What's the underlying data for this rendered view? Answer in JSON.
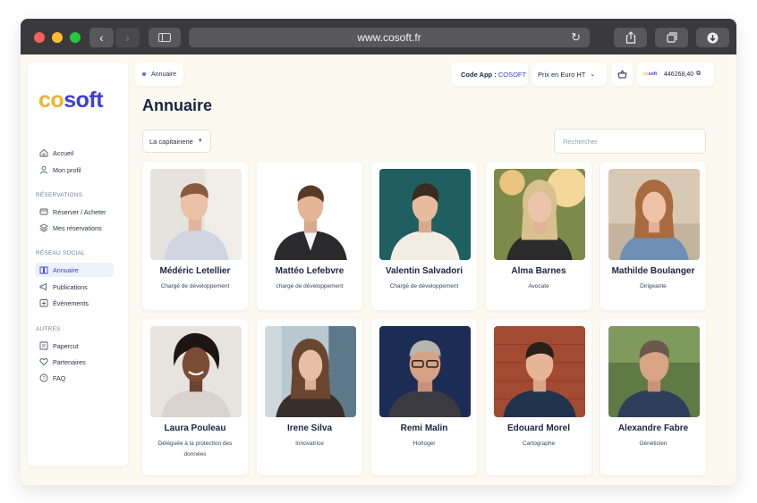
{
  "browser": {
    "url": "www.cosoft.fr"
  },
  "logo": {
    "part1": "co",
    "part2": "soft"
  },
  "sidebar": {
    "items_top": [
      {
        "label": "Accueil",
        "icon": "home-icon"
      },
      {
        "label": "Mon profil",
        "icon": "user-icon"
      }
    ],
    "section_reservations": "RÉSERVATIONS",
    "items_reservations": [
      {
        "label": "Réserver / Acheter",
        "icon": "cart-icon"
      },
      {
        "label": "Mes réservations",
        "icon": "layers-icon"
      }
    ],
    "section_social": "RÉSEAU SOCIAL",
    "items_social": [
      {
        "label": "Annuaire",
        "icon": "book-icon",
        "active": true
      },
      {
        "label": "Publications",
        "icon": "megaphone-icon"
      },
      {
        "label": "Événements",
        "icon": "calendar-plus-icon"
      }
    ],
    "section_others": "AUTRES",
    "items_others": [
      {
        "label": "Papercut",
        "icon": "printer-icon"
      },
      {
        "label": "Partenaires",
        "icon": "heart-icon"
      },
      {
        "label": "FAQ",
        "icon": "help-icon"
      }
    ]
  },
  "header": {
    "breadcrumb": "Annuaire",
    "code_app_label": "Code App :",
    "code_app_value": "COSOFT",
    "price_mode": "Prix en Euro HT",
    "wallet_brand": "cosoft",
    "wallet_amount": "446268,40"
  },
  "main": {
    "title": "Annuaire",
    "filter_value": "La capitainerie",
    "search_placeholder": "Rechercher"
  },
  "people": [
    {
      "name": "Médéric Letellier",
      "role": "Chargé de développement"
    },
    {
      "name": "Mattéo Lefebvre",
      "role": "chargé de développement"
    },
    {
      "name": "Valentin Salvadori",
      "role": "Chargé de développement"
    },
    {
      "name": "Alma Barnes",
      "role": "Avocate"
    },
    {
      "name": "Mathilde Boulanger",
      "role": "Dirigeante"
    },
    {
      "name": "Laura Pouleau",
      "role": "Déléguée à la protection des données"
    },
    {
      "name": "Irene Silva",
      "role": "Innovatrice"
    },
    {
      "name": "Remi Malin",
      "role": "Horloger"
    },
    {
      "name": "Edouard Morel",
      "role": "Cartographe"
    },
    {
      "name": "Alexandre Fabre",
      "role": "Généticien"
    }
  ],
  "colors": {
    "accent": "#3b3fd8",
    "logo_yellow": "#f2b233",
    "text_dark": "#1d2340",
    "background": "#fcf9f1"
  }
}
